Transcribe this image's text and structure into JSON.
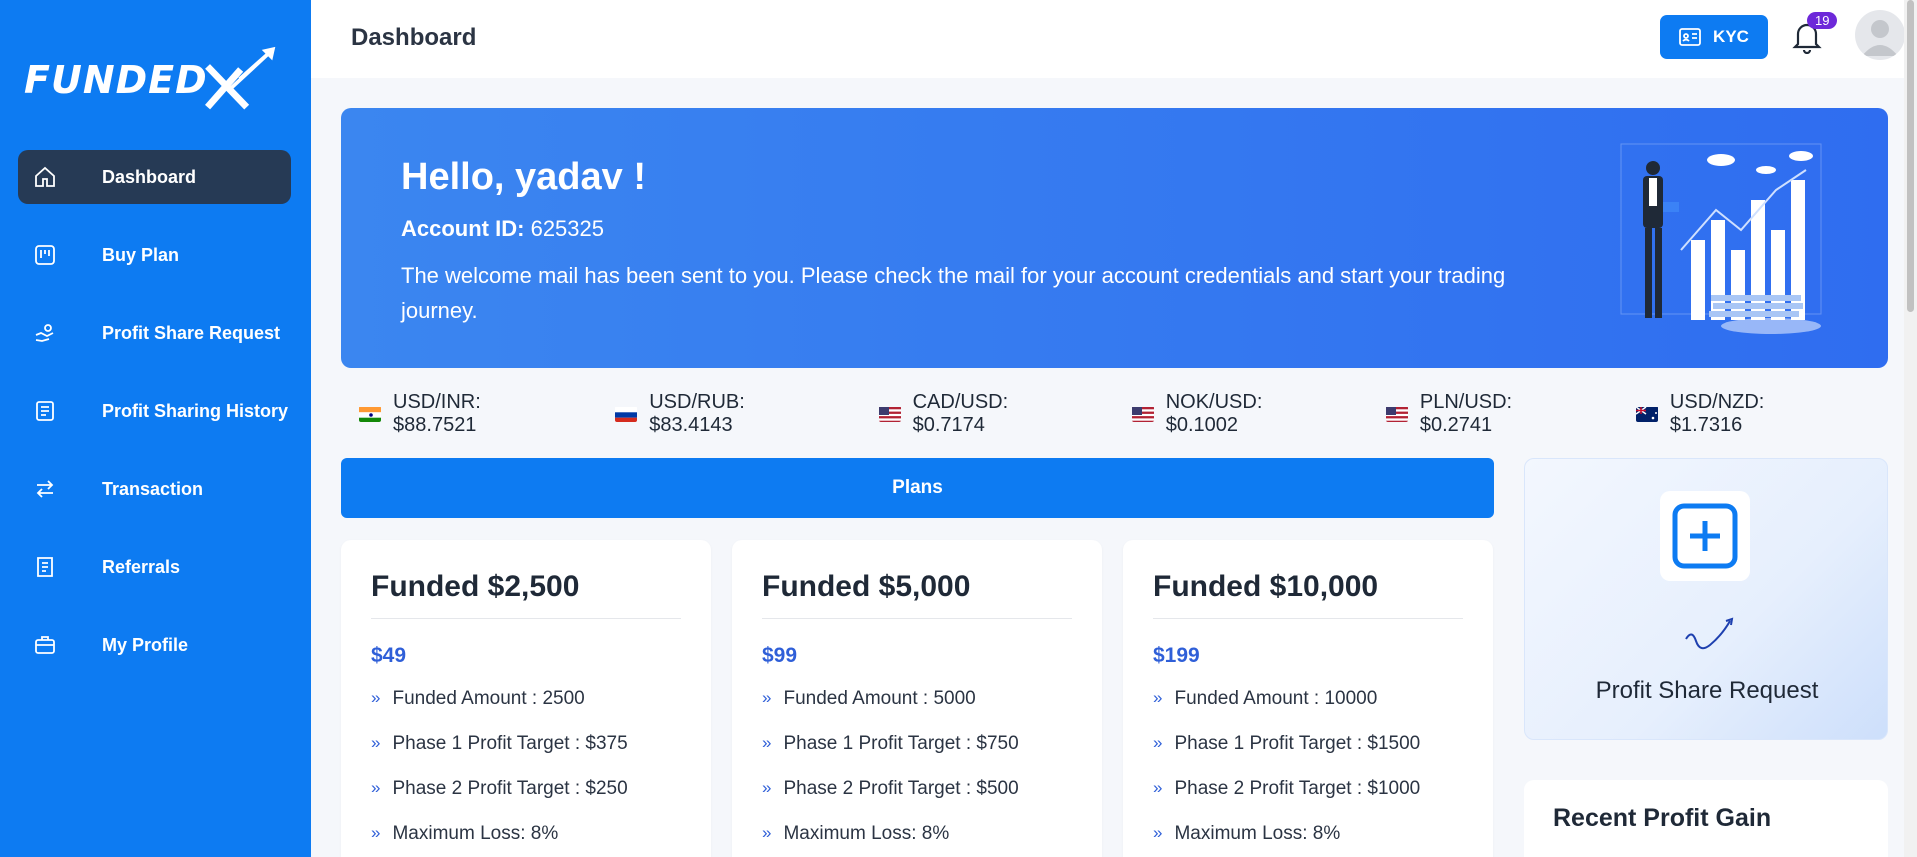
{
  "brand": {
    "logo_text": "FUNDED"
  },
  "sidebar": {
    "items": [
      {
        "label": "Dashboard",
        "icon": "home-icon",
        "active": true
      },
      {
        "label": "Buy Plan",
        "icon": "kanban-icon"
      },
      {
        "label": "Profit Share Request",
        "icon": "hand-coins-icon"
      },
      {
        "label": "Profit Sharing History",
        "icon": "list-document-icon"
      },
      {
        "label": "Transaction",
        "icon": "swap-arrows-icon"
      },
      {
        "label": "Referrals",
        "icon": "receipt-icon"
      },
      {
        "label": "My Profile",
        "icon": "briefcase-icon"
      }
    ]
  },
  "header": {
    "title": "Dashboard",
    "kyc_label": "KYC",
    "notification_count": "19"
  },
  "hero": {
    "greeting": "Hello, yadav !",
    "account_label": "Account ID:",
    "account_id": "625325",
    "message": "The welcome mail has been sent to you. Please check the mail for your account credentials and start your trading journey."
  },
  "ticker": [
    {
      "pair": "USD/INR: $88.7521",
      "flag": "india-flag-icon"
    },
    {
      "pair": "USD/RUB: $83.4143",
      "flag": "russia-flag-icon"
    },
    {
      "pair": "CAD/USD: $0.7174",
      "flag": "us-flag-icon"
    },
    {
      "pair": "NOK/USD: $0.1002",
      "flag": "us-flag-icon"
    },
    {
      "pair": "PLN/USD: $0.2741",
      "flag": "us-flag-icon"
    },
    {
      "pair": "USD/NZD: $1.7316",
      "flag": "australia-flag-icon"
    }
  ],
  "plans": {
    "label": "Plans",
    "cards": [
      {
        "title": "Funded $2,500",
        "price": "$49",
        "features": [
          "Funded Amount : 2500",
          "Phase 1 Profit Target : $375",
          "Phase 2 Profit Target : $250",
          "Maximum Loss: 8%"
        ]
      },
      {
        "title": "Funded $5,000",
        "price": "$99",
        "features": [
          "Funded Amount : 5000",
          "Phase 1 Profit Target : $750",
          "Phase 2 Profit Target : $500",
          "Maximum Loss: 8%"
        ]
      },
      {
        "title": "Funded $10,000",
        "price": "$199",
        "features": [
          "Funded Amount : 10000",
          "Phase 1 Profit Target : $1500",
          "Phase 2 Profit Target : $1000",
          "Maximum Loss: 8%"
        ]
      }
    ]
  },
  "widgets": {
    "profit_share_request": "Profit Share Request",
    "recent_profit_gain": "Recent Profit Gain"
  },
  "colors": {
    "primary": "#0d7bf2",
    "sidebar_active": "#263a55",
    "accent_price": "#2f5fd8"
  }
}
